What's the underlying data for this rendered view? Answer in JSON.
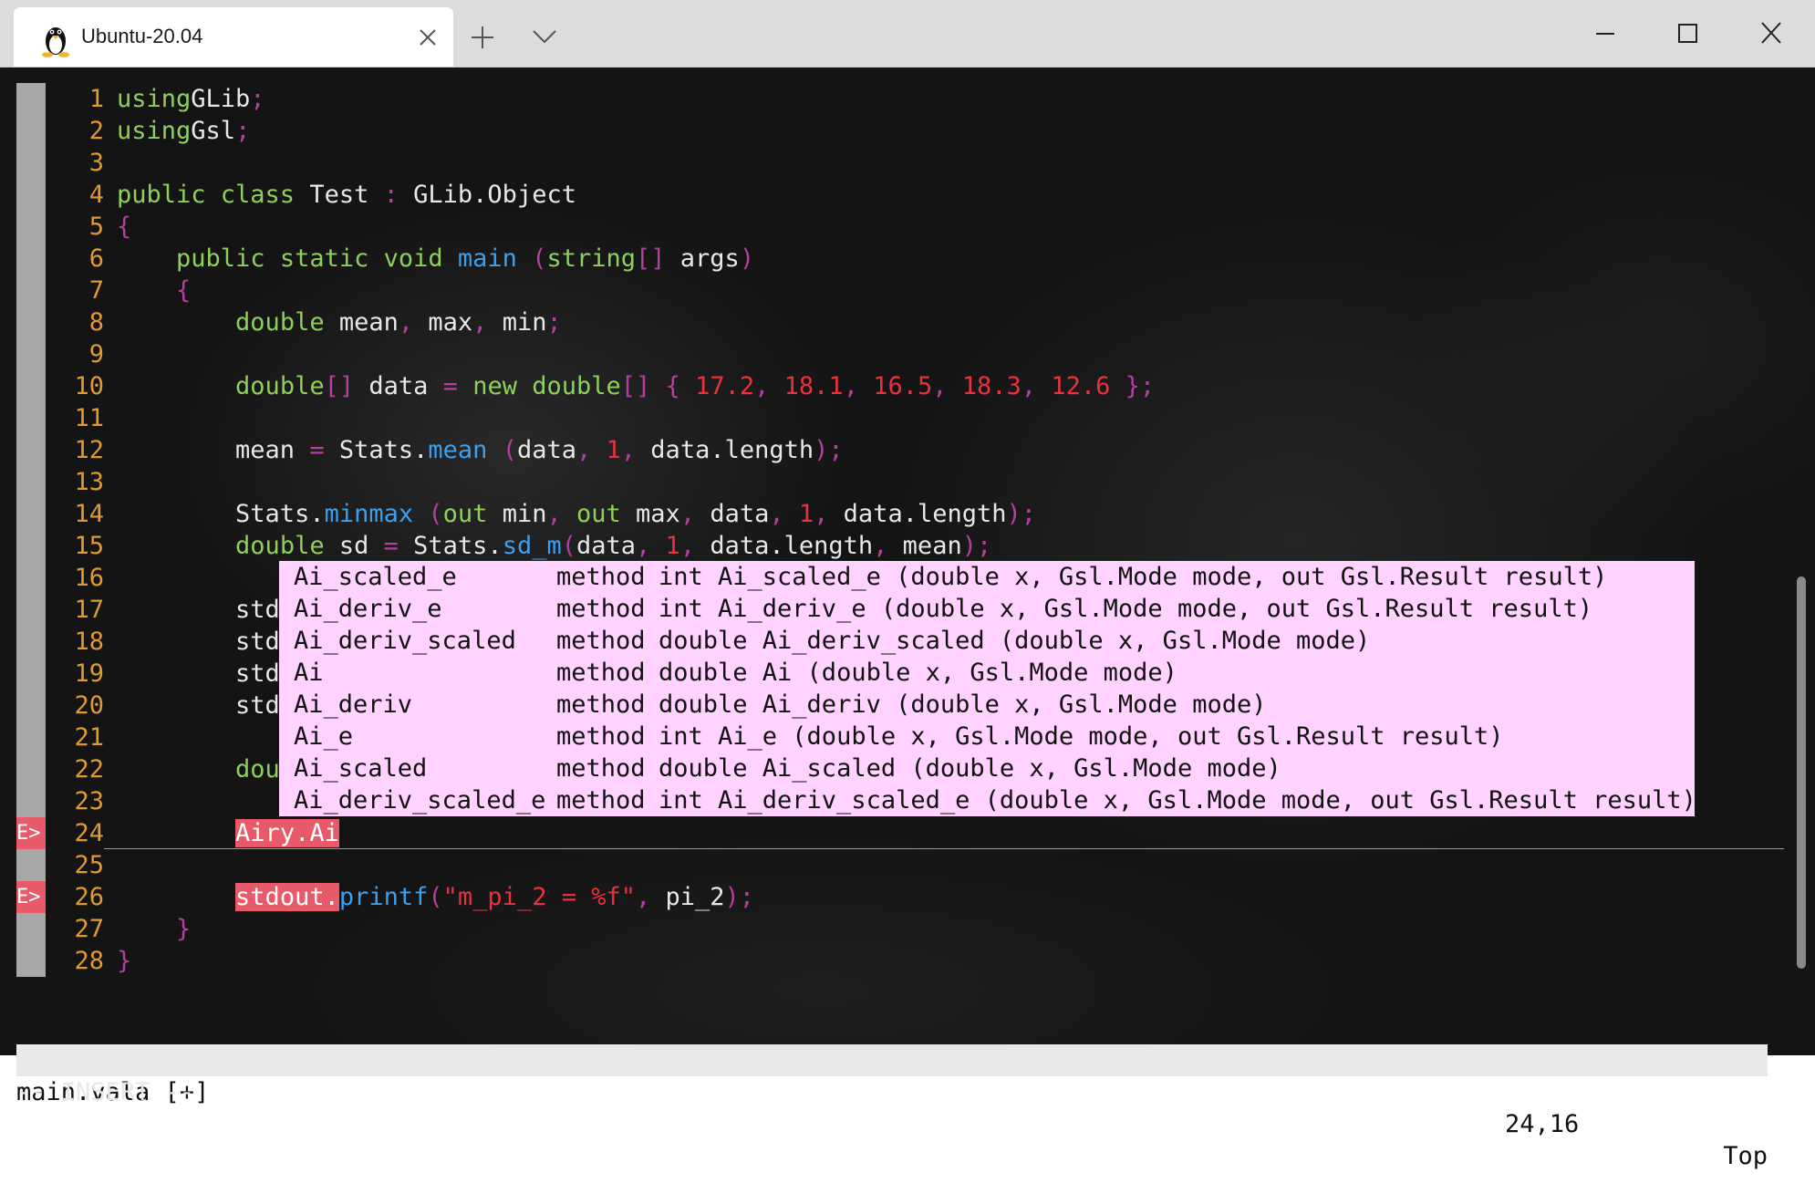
{
  "window": {
    "tab_title": "Ubuntu-20.04",
    "icons": {
      "tab": "linux-penguin-icon",
      "close_tab": "close-icon",
      "new_tab": "plus-icon",
      "dropdown": "chevron-down-icon",
      "minimize": "minimize-icon",
      "maximize": "maximize-icon",
      "close_window": "close-icon"
    }
  },
  "editor": {
    "file_name": "main.vala",
    "sign_error_text": "E>",
    "lines": [
      {
        "n": "1",
        "sign": "",
        "tokens": [
          [
            "kw",
            "using"
          ],
          [
            "",
            "GLib"
          ],
          [
            "pu",
            ";"
          ]
        ]
      },
      {
        "n": "2",
        "sign": "",
        "tokens": [
          [
            "kw",
            "using"
          ],
          [
            "",
            "Gsl"
          ],
          [
            "pu",
            ";"
          ]
        ]
      },
      {
        "n": "3",
        "sign": "",
        "tokens": []
      },
      {
        "n": "4",
        "sign": "",
        "tokens": [
          [
            "kw",
            "public class"
          ],
          [
            "",
            " Test "
          ],
          [
            "pu",
            ":"
          ],
          [
            "",
            " GLib.Object"
          ]
        ]
      },
      {
        "n": "5",
        "sign": "",
        "tokens": [
          [
            "pu",
            "{"
          ]
        ]
      },
      {
        "n": "6",
        "sign": "",
        "tokens": [
          [
            "",
            "    "
          ],
          [
            "kw",
            "public static void"
          ],
          [
            "",
            " "
          ],
          [
            "fn",
            "main"
          ],
          [
            "",
            " "
          ],
          [
            "pu",
            "("
          ],
          [
            "kw",
            "string"
          ],
          [
            "pu",
            "[]"
          ],
          [
            "",
            " args"
          ],
          [
            "pu",
            ")"
          ]
        ]
      },
      {
        "n": "7",
        "sign": "",
        "tokens": [
          [
            "",
            "    "
          ],
          [
            "pu",
            "{"
          ]
        ]
      },
      {
        "n": "8",
        "sign": "",
        "tokens": [
          [
            "",
            "        "
          ],
          [
            "kw",
            "double"
          ],
          [
            "",
            " mean"
          ],
          [
            "pu",
            ","
          ],
          [
            "",
            " max"
          ],
          [
            "pu",
            ","
          ],
          [
            "",
            " min"
          ],
          [
            "pu",
            ";"
          ]
        ]
      },
      {
        "n": "9",
        "sign": "",
        "tokens": []
      },
      {
        "n": "10",
        "sign": "",
        "tokens": [
          [
            "",
            "        "
          ],
          [
            "kw",
            "double"
          ],
          [
            "pu",
            "[]"
          ],
          [
            "",
            " data "
          ],
          [
            "pu",
            "="
          ],
          [
            "",
            " "
          ],
          [
            "kw",
            "new"
          ],
          [
            "",
            " "
          ],
          [
            "kw",
            "double"
          ],
          [
            "pu",
            "[]"
          ],
          [
            "",
            " "
          ],
          [
            "pu",
            "{"
          ],
          [
            "",
            " "
          ],
          [
            "nu",
            "17.2"
          ],
          [
            "pu",
            ","
          ],
          [
            "",
            " "
          ],
          [
            "nu",
            "18.1"
          ],
          [
            "pu",
            ","
          ],
          [
            "",
            " "
          ],
          [
            "nu",
            "16.5"
          ],
          [
            "pu",
            ","
          ],
          [
            "",
            " "
          ],
          [
            "nu",
            "18.3"
          ],
          [
            "pu",
            ","
          ],
          [
            "",
            " "
          ],
          [
            "nu",
            "12.6"
          ],
          [
            "",
            " "
          ],
          [
            "pu",
            "};"
          ]
        ]
      },
      {
        "n": "11",
        "sign": "",
        "tokens": []
      },
      {
        "n": "12",
        "sign": "",
        "tokens": [
          [
            "",
            "        mean "
          ],
          [
            "pu",
            "="
          ],
          [
            "",
            " Stats."
          ],
          [
            "fn",
            "mean"
          ],
          [
            "",
            " "
          ],
          [
            "pu",
            "("
          ],
          [
            "",
            "data"
          ],
          [
            "pu",
            ","
          ],
          [
            "",
            " "
          ],
          [
            "nu",
            "1"
          ],
          [
            "pu",
            ","
          ],
          [
            "",
            " data.length"
          ],
          [
            "pu",
            ");"
          ]
        ]
      },
      {
        "n": "13",
        "sign": "",
        "tokens": []
      },
      {
        "n": "14",
        "sign": "",
        "tokens": [
          [
            "",
            "        Stats."
          ],
          [
            "fn",
            "minmax"
          ],
          [
            "",
            " "
          ],
          [
            "pu",
            "("
          ],
          [
            "kw",
            "out"
          ],
          [
            "",
            " min"
          ],
          [
            "pu",
            ","
          ],
          [
            "",
            " "
          ],
          [
            "kw",
            "out"
          ],
          [
            "",
            " max"
          ],
          [
            "pu",
            ","
          ],
          [
            "",
            " data"
          ],
          [
            "pu",
            ","
          ],
          [
            "",
            " "
          ],
          [
            "nu",
            "1"
          ],
          [
            "pu",
            ","
          ],
          [
            "",
            " data.length"
          ],
          [
            "pu",
            ");"
          ]
        ]
      },
      {
        "n": "15",
        "sign": "",
        "tokens": [
          [
            "",
            "        "
          ],
          [
            "kw",
            "double"
          ],
          [
            "",
            " sd "
          ],
          [
            "pu",
            "="
          ],
          [
            "",
            " Stats."
          ],
          [
            "fn",
            "sd_m"
          ],
          [
            "pu",
            "("
          ],
          [
            "",
            "data"
          ],
          [
            "pu",
            ","
          ],
          [
            "",
            " "
          ],
          [
            "nu",
            "1"
          ],
          [
            "pu",
            ","
          ],
          [
            "",
            " data.length"
          ],
          [
            "pu",
            ","
          ],
          [
            "",
            " mean"
          ],
          [
            "pu",
            ");"
          ]
        ]
      },
      {
        "n": "16",
        "sign": "",
        "tokens": []
      },
      {
        "n": "17",
        "sign": "",
        "tokens": [
          [
            "",
            "        stdo"
          ]
        ]
      },
      {
        "n": "18",
        "sign": "",
        "tokens": [
          [
            "",
            "        stdo"
          ]
        ]
      },
      {
        "n": "19",
        "sign": "",
        "tokens": [
          [
            "",
            "        stdo"
          ]
        ]
      },
      {
        "n": "20",
        "sign": "",
        "tokens": [
          [
            "",
            "        stdo"
          ]
        ]
      },
      {
        "n": "21",
        "sign": "",
        "tokens": []
      },
      {
        "n": "22",
        "sign": "",
        "tokens": [
          [
            "",
            "        "
          ],
          [
            "kw",
            "doub"
          ]
        ]
      },
      {
        "n": "23",
        "sign": "",
        "tokens": []
      },
      {
        "n": "24",
        "sign": "E",
        "cursor": true,
        "tokens": [
          [
            "",
            "        "
          ],
          [
            "er",
            "Airy.Ai"
          ]
        ]
      },
      {
        "n": "25",
        "sign": "",
        "tokens": []
      },
      {
        "n": "26",
        "sign": "E",
        "tokens": [
          [
            "",
            "        "
          ],
          [
            "er",
            "stdout."
          ],
          [
            "fn",
            "printf"
          ],
          [
            "pu",
            "("
          ],
          [
            "st",
            "\"m_pi_2 = %f\""
          ],
          [
            "pu",
            ","
          ],
          [
            "",
            " pi_2"
          ],
          [
            "pu",
            ");"
          ]
        ]
      },
      {
        "n": "27",
        "sign": "",
        "tokens": [
          [
            "",
            "    "
          ],
          [
            "pu",
            "}"
          ]
        ]
      },
      {
        "n": "28",
        "sign": "",
        "tokens": [
          [
            "pu",
            "}"
          ]
        ]
      }
    ]
  },
  "completion": {
    "items": [
      {
        "word": "Ai_scaled_e",
        "kind": "method",
        "sig": "int Ai_scaled_e (double x, Gsl.Mode mode, out Gsl.Result result)"
      },
      {
        "word": "Ai_deriv_e",
        "kind": "method",
        "sig": "int Ai_deriv_e (double x, Gsl.Mode mode, out Gsl.Result result)"
      },
      {
        "word": "Ai_deriv_scaled",
        "kind": "method",
        "sig": "double Ai_deriv_scaled (double x, Gsl.Mode mode)"
      },
      {
        "word": "Ai",
        "kind": "method",
        "sig": "double Ai (double x, Gsl.Mode mode)"
      },
      {
        "word": "Ai_deriv",
        "kind": "method",
        "sig": "double Ai_deriv (double x, Gsl.Mode mode)"
      },
      {
        "word": "Ai_e",
        "kind": "method",
        "sig": "int Ai_e (double x, Gsl.Mode mode, out Gsl.Result result)"
      },
      {
        "word": "Ai_scaled",
        "kind": "method",
        "sig": "double Ai_scaled (double x, Gsl.Mode mode)"
      },
      {
        "word": "Ai_deriv_scaled_e",
        "kind": "method",
        "sig": "int Ai_deriv_scaled_e (double x, Gsl.Mode mode, out Gsl.Result result)"
      }
    ]
  },
  "status": {
    "file": "main.vala [+]",
    "position": "24,16",
    "scroll": "Top",
    "mode": "-- INSERT --"
  },
  "colors": {
    "keyword": "#8ed05a",
    "punctuation": "#b53fa0",
    "function": "#3aa0f0",
    "number": "#e8323c",
    "line_number": "#e09a30",
    "error_sign": "#e85a6a",
    "popup_bg": "#ffd2ff"
  }
}
